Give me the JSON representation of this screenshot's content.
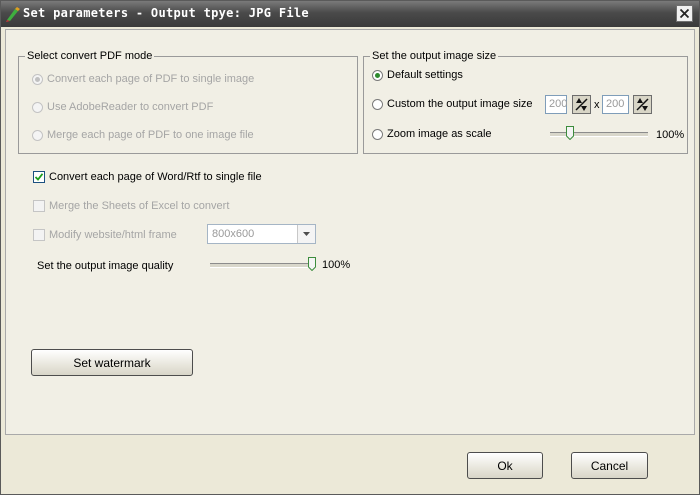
{
  "window": {
    "title": "Set parameters - Output tpye: JPG File"
  },
  "pdf_mode": {
    "legend": "Select convert PDF mode",
    "options": [
      {
        "label": "Convert each page of PDF to single image",
        "selected": true,
        "enabled": false
      },
      {
        "label": "Use AdobeReader to convert PDF",
        "selected": false,
        "enabled": false
      },
      {
        "label": "Merge each page of PDF to one image file",
        "selected": false,
        "enabled": false
      }
    ]
  },
  "image_size": {
    "legend": "Set the output image size",
    "default_label": "Default settings",
    "custom_label": "Custom the output image size",
    "width_value": "200",
    "times_sign": "x",
    "height_value": "200",
    "zoom_label": "Zoom image as scale",
    "zoom_percent": "100%",
    "zoom_level": 0.18,
    "selected": "default"
  },
  "word_option": {
    "label": "Convert each page of Word/Rtf to single file",
    "checked": true
  },
  "excel_option": {
    "label": "Merge the Sheets of Excel to convert",
    "checked": false,
    "enabled": false
  },
  "website_option": {
    "label": "Modify website/html frame",
    "checked": false,
    "enabled": false,
    "frame_value": "800x600"
  },
  "quality": {
    "label": "Set the output image quality",
    "percent": "100%",
    "level": 1.0
  },
  "watermark_button": "Set watermark",
  "ok_button": "Ok",
  "cancel_button": "Cancel",
  "colors": {
    "title_bar": "#4a4a4a",
    "dialog_bg": "#ece9d8",
    "selected_radio": "#2e8b2e"
  }
}
